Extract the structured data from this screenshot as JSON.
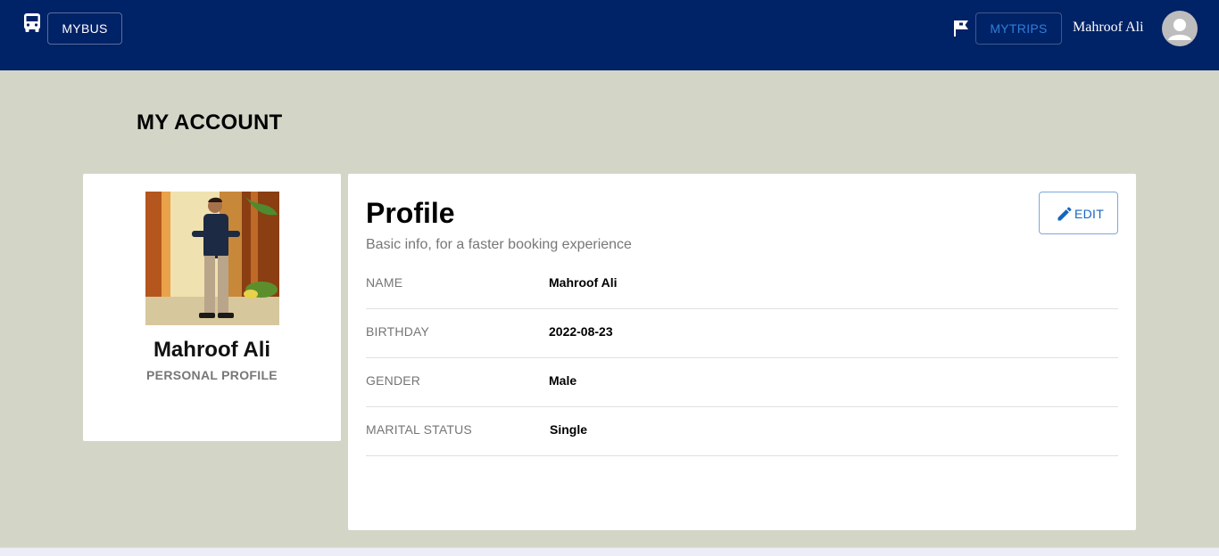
{
  "appbar": {
    "brand_label": "MYBUS",
    "mytrips_label": "MYTRIPS",
    "user_name": "Mahroof Ali",
    "colors": {
      "background": "#002266",
      "mytrips_text": "#2f7fd9"
    }
  },
  "page": {
    "heading": "MY ACCOUNT"
  },
  "left_card": {
    "name": "Mahroof Ali",
    "subtitle": "PERSONAL PROFILE"
  },
  "profile": {
    "title": "Profile",
    "subtitle": "Basic info, for a faster booking experience",
    "edit_label": "EDIT",
    "fields": [
      {
        "label": "NAME",
        "value": "Mahroof Ali"
      },
      {
        "label": "BIRTHDAY",
        "value": "2022-08-23"
      },
      {
        "label": "GENDER",
        "value": "Male"
      },
      {
        "label": "MARITAL STATUS",
        "value": "Single"
      }
    ]
  },
  "icons": [
    "bus-icon",
    "flag-icon",
    "avatar-icon",
    "pencil-icon"
  ],
  "colors": {
    "page_bg": "#d3d6c7",
    "edit_accent": "#1565c0"
  }
}
